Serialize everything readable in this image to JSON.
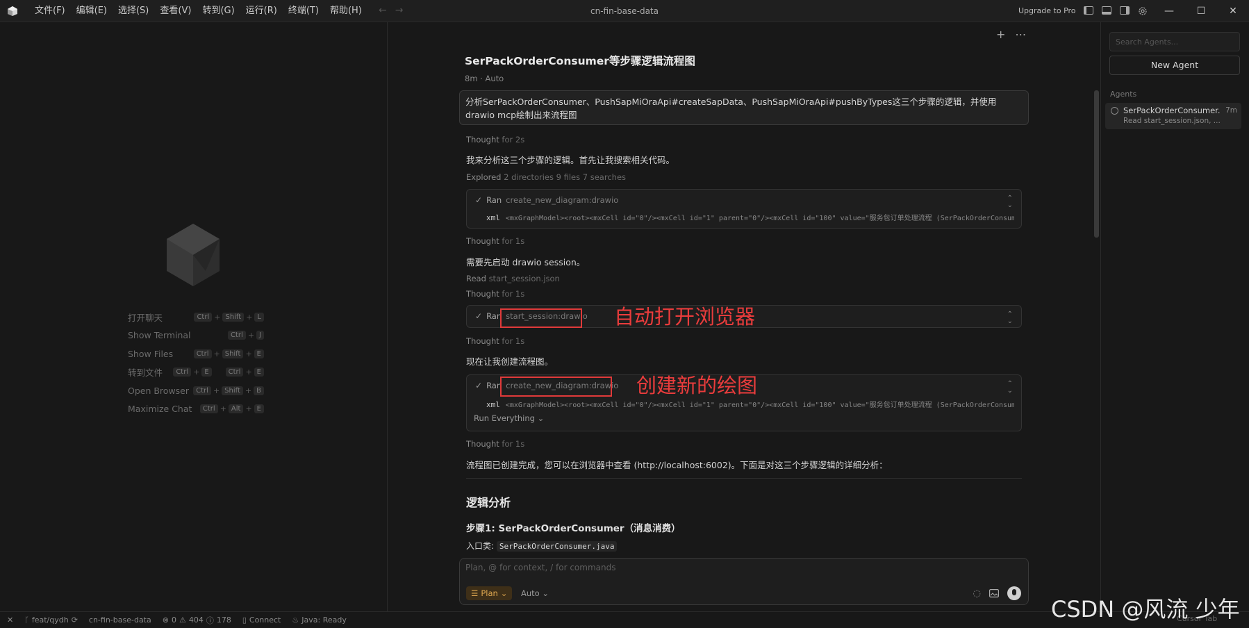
{
  "window": {
    "title": "cn-fin-base-data",
    "upgrade": "Upgrade to Pro",
    "menu": [
      "文件(F)",
      "编辑(E)",
      "选择(S)",
      "查看(V)",
      "转到(G)",
      "运行(R)",
      "终端(T)",
      "帮助(H)"
    ],
    "controls": [
      "—",
      "☐",
      "✕"
    ]
  },
  "empty_editor": {
    "shortcuts": [
      {
        "label": "打开聊天",
        "keys": [
          [
            "Ctrl",
            "Shift",
            "L"
          ]
        ]
      },
      {
        "label": "Show Terminal",
        "keys": [
          [
            "Ctrl",
            "J"
          ]
        ]
      },
      {
        "label": "Show Files",
        "keys": [
          [
            "Ctrl",
            "Shift",
            "E"
          ]
        ]
      },
      {
        "label": "转到文件",
        "keys": [
          [
            "Ctrl",
            "E"
          ],
          [
            "Ctrl",
            "E"
          ]
        ]
      },
      {
        "label": "Open Browser",
        "keys": [
          [
            "Ctrl",
            "Shift",
            "B"
          ]
        ]
      },
      {
        "label": "Maximize Chat",
        "keys": [
          [
            "Ctrl",
            "Alt",
            "E"
          ]
        ]
      }
    ]
  },
  "chat": {
    "title": "SerPackOrderConsumer等步骤逻辑流程图",
    "meta": "8m · Auto",
    "user_message": "分析SerPackOrderConsumer、PushSapMiOraApi#createSapData、PushSapMiOraApi#pushByTypes这三个步骤的逻辑，并使用drawio mcp绘制出来流程图",
    "thought1": {
      "label": "Thought",
      "time": "for 2s"
    },
    "para1": "我来分析这三个步骤的逻辑。首先让我搜索相关代码。",
    "explored": {
      "label": "Explored",
      "detail": "2 directories 9 files 7 searches"
    },
    "tool1": {
      "check": "✓",
      "ran": "Ran",
      "name": "create_new_diagram:drawio",
      "xml_label": "xml",
      "xml": "<mxGraphModel><root><mxCell id=\"0\"/><mxCell id=\"1\" parent=\"0\"/><mxCell id=\"100\" value=\"服务包订单处理流程 (SerPackOrderConsumer)\" style=\"text;html=1;\"/></root></mxGraphModel>"
    },
    "thought2": {
      "label": "Thought",
      "time": "for 1s"
    },
    "para2": "需要先启动 drawio session。",
    "read": {
      "label": "Read",
      "detail": "start_session.json"
    },
    "thought3": {
      "label": "Thought",
      "time": "for 1s"
    },
    "tool2": {
      "check": "✓",
      "ran": "Ran",
      "name": "start_session:drawio"
    },
    "annot1": "自动打开浏览器",
    "thought4": {
      "label": "Thought",
      "time": "for 1s"
    },
    "para3": "现在让我创建流程图。",
    "tool3": {
      "check": "✓",
      "ran": "Ran",
      "name": "create_new_diagram:drawio",
      "xml_label": "xml",
      "xml": "<mxGraphModel><root><mxCell id=\"0\"/><mxCell id=\"1\" parent=\"0\"/><mxCell id=\"100\" value=\"服务包订单处理流程 (SerPackOrderConsumer)\" style=\"text;html=1;\"/></root></mxGraphModel>",
      "run_everything": "Run Everything"
    },
    "annot2": "创建新的绘图",
    "thought5": {
      "label": "Thought",
      "time": "for 1s"
    },
    "para4": "流程图已创建完成，您可以在浏览器中查看 (http://localhost:6002)。下面是对这三个步骤逻辑的详细分析：",
    "heading_logic": "逻辑分析",
    "heading_step1": "步骤1: SerPackOrderConsumer（消息消费）",
    "entry_label": "入口类:",
    "entry_code": "SerPackOrderConsumer.java"
  },
  "composer": {
    "placeholder": "Plan, @ for context, / for commands",
    "mode": "Plan",
    "model": "Auto"
  },
  "agents": {
    "search_placeholder": "Search Agents...",
    "new_agent": "New Agent",
    "section_label": "Agents",
    "items": [
      {
        "name": "SerPackOrderConsumer...",
        "time": "7m",
        "sub": "Read start_session.json, ..."
      }
    ]
  },
  "status": {
    "branch": "feat/qydh",
    "project": "cn-fin-base-data",
    "errors": "0",
    "warnings": "404",
    "infos": "178",
    "connect": "Connect",
    "java": "Java: Ready",
    "cursor_tab": "Cursor Tab"
  },
  "watermark": "CSDN @风流 少年",
  "colors": {
    "accent_orange": "#e0a850",
    "annotation_red": "#ea3c3c",
    "background": "#181818"
  }
}
